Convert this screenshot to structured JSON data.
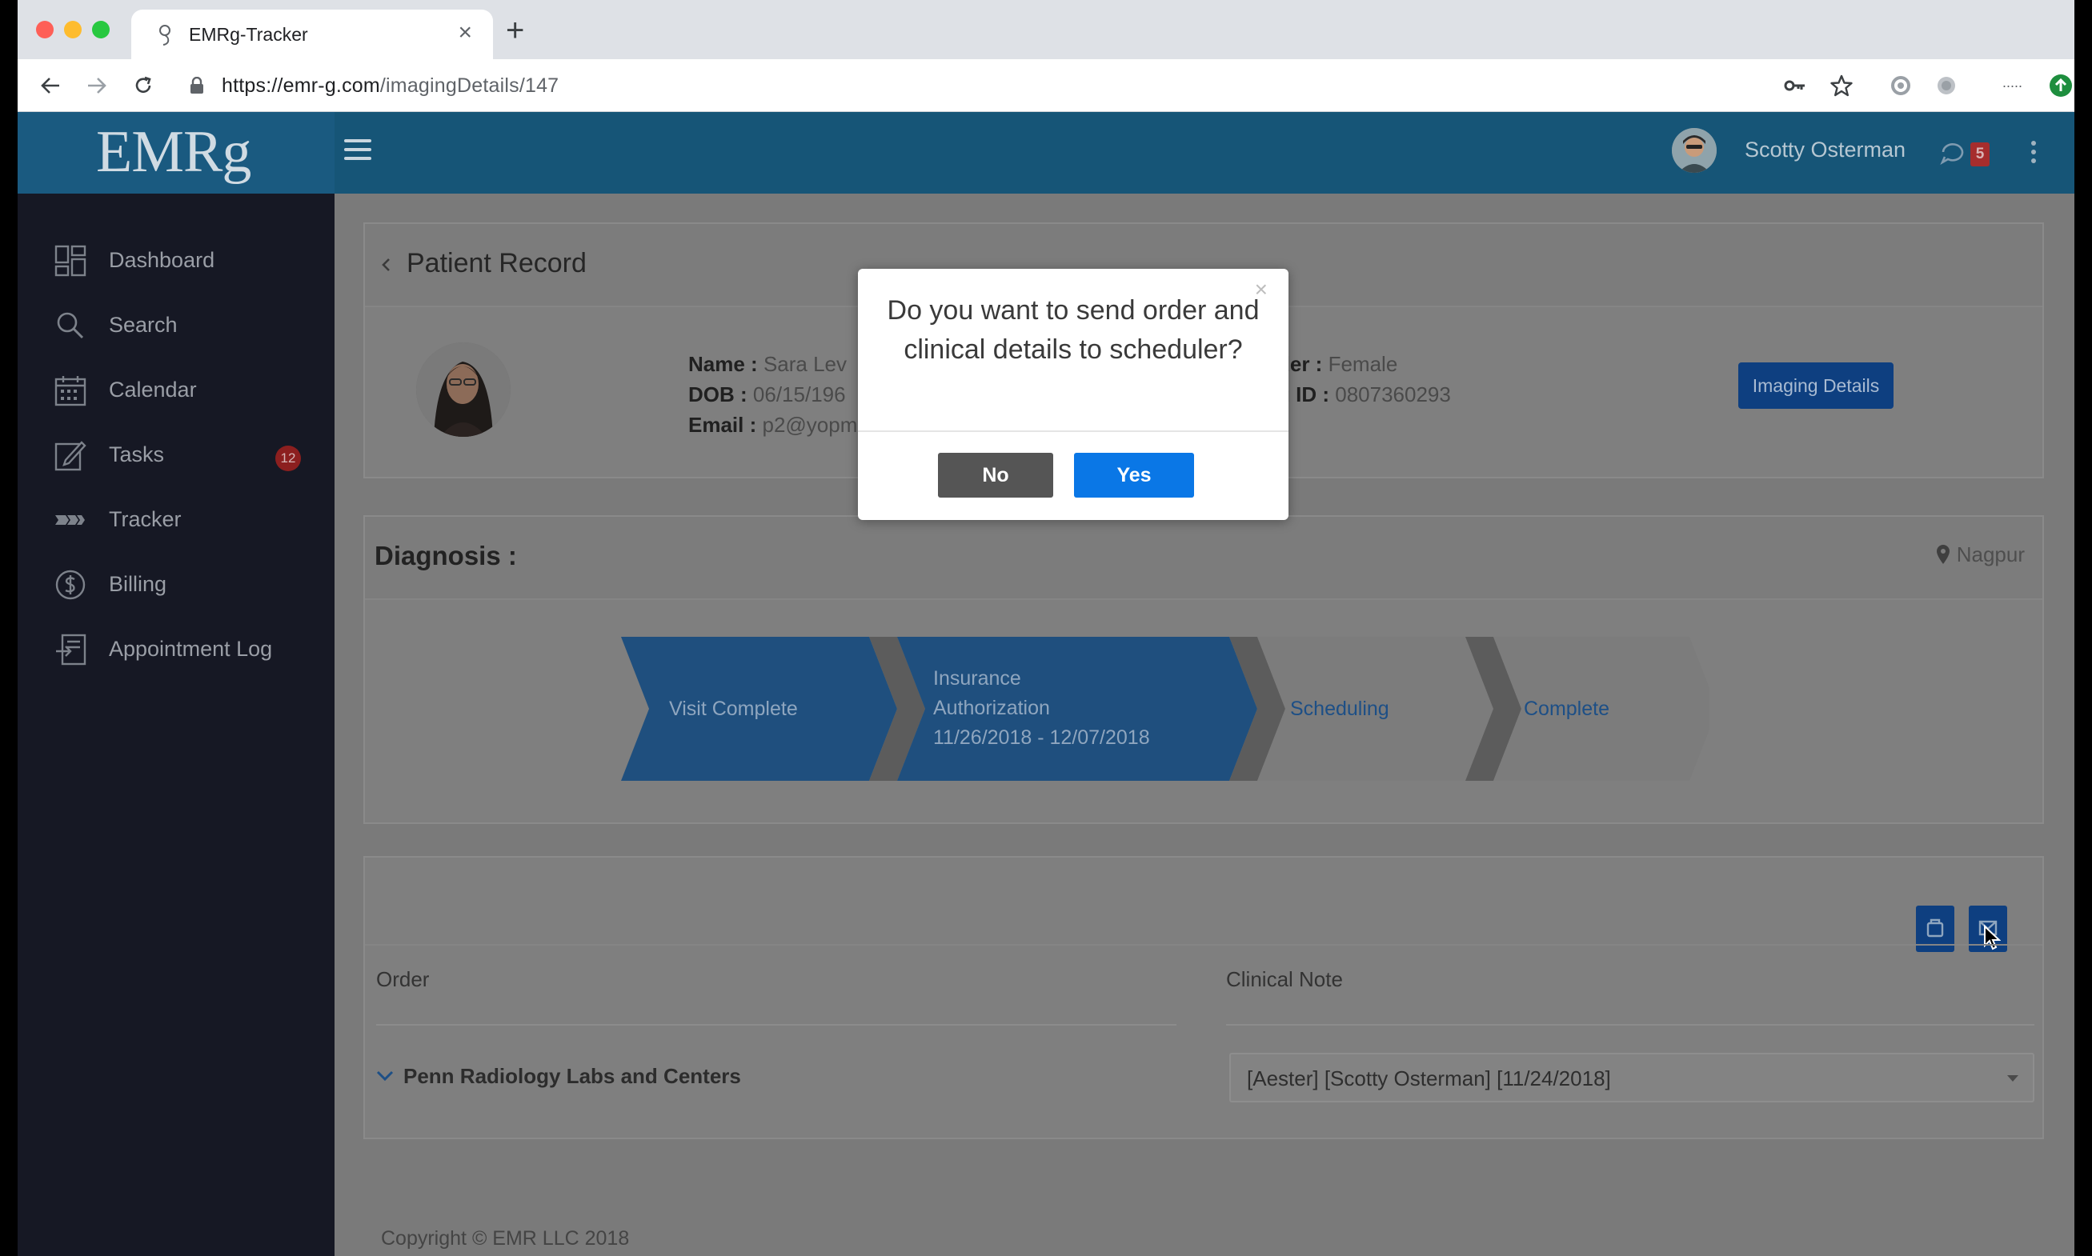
{
  "browser": {
    "tab_title": "EMRg-Tracker",
    "tab_close": "×",
    "new_tab": "+",
    "url_host": "https://emr-g.com",
    "url_path": "/imagingDetails/147",
    "toolbar_more": "·····"
  },
  "header": {
    "logo": "EMRg",
    "user_name": "Scotty Osterman",
    "notification_count": "5"
  },
  "sidebar": {
    "items": [
      {
        "label": "Dashboard",
        "icon": "dashboard-icon"
      },
      {
        "label": "Search",
        "icon": "search-icon"
      },
      {
        "label": "Calendar",
        "icon": "calendar-icon"
      },
      {
        "label": "Tasks",
        "icon": "edit-icon",
        "badge": "12"
      },
      {
        "label": "Tracker",
        "icon": "tracker-icon"
      },
      {
        "label": "Billing",
        "icon": "dollar-icon"
      },
      {
        "label": "Appointment Log",
        "icon": "log-icon"
      }
    ]
  },
  "patient": {
    "section_title": "Patient Record",
    "name_label": "Name :",
    "name_value": "Sara Lev",
    "dob_label": "DOB :",
    "dob_value": "06/15/196",
    "email_label": "Email :",
    "email_value": "p2@yopmail.com",
    "gender_label": "der :",
    "gender_value": "Female",
    "id_label": "g ID :",
    "id_value": "0807360293",
    "imaging_button": "Imaging Details"
  },
  "diagnosis": {
    "title": "Diagnosis :",
    "location": "Nagpur",
    "steps": [
      {
        "label": "Visit Complete",
        "active": true
      },
      {
        "label": "Insurance Authorization 11/26/2018 - 12/07/2018",
        "lines": [
          "Insurance",
          "Authorization",
          "11/26/2018 - 12/07/2018"
        ],
        "active": true
      },
      {
        "label": "Scheduling",
        "active": false
      },
      {
        "label": "Complete",
        "active": false
      }
    ]
  },
  "orders": {
    "order_header": "Order",
    "note_header": "Clinical Note",
    "order_row": "Penn Radiology Labs and Centers",
    "note_selected": "[Aester] [Scotty Osterman] [11/24/2018]"
  },
  "footer": {
    "copyright": "Copyright © EMR LLC 2018"
  },
  "modal": {
    "question": "Do you want to send order and clinical details to scheduler?",
    "close": "×",
    "no_label": "No",
    "yes_label": "Yes"
  },
  "colors": {
    "accent_blue": "#0a77e6",
    "header_blue": "#165577",
    "sidebar_dark": "#161824",
    "pipeline_active": "#1f4f7e",
    "badge_red": "#8c1f1f"
  }
}
